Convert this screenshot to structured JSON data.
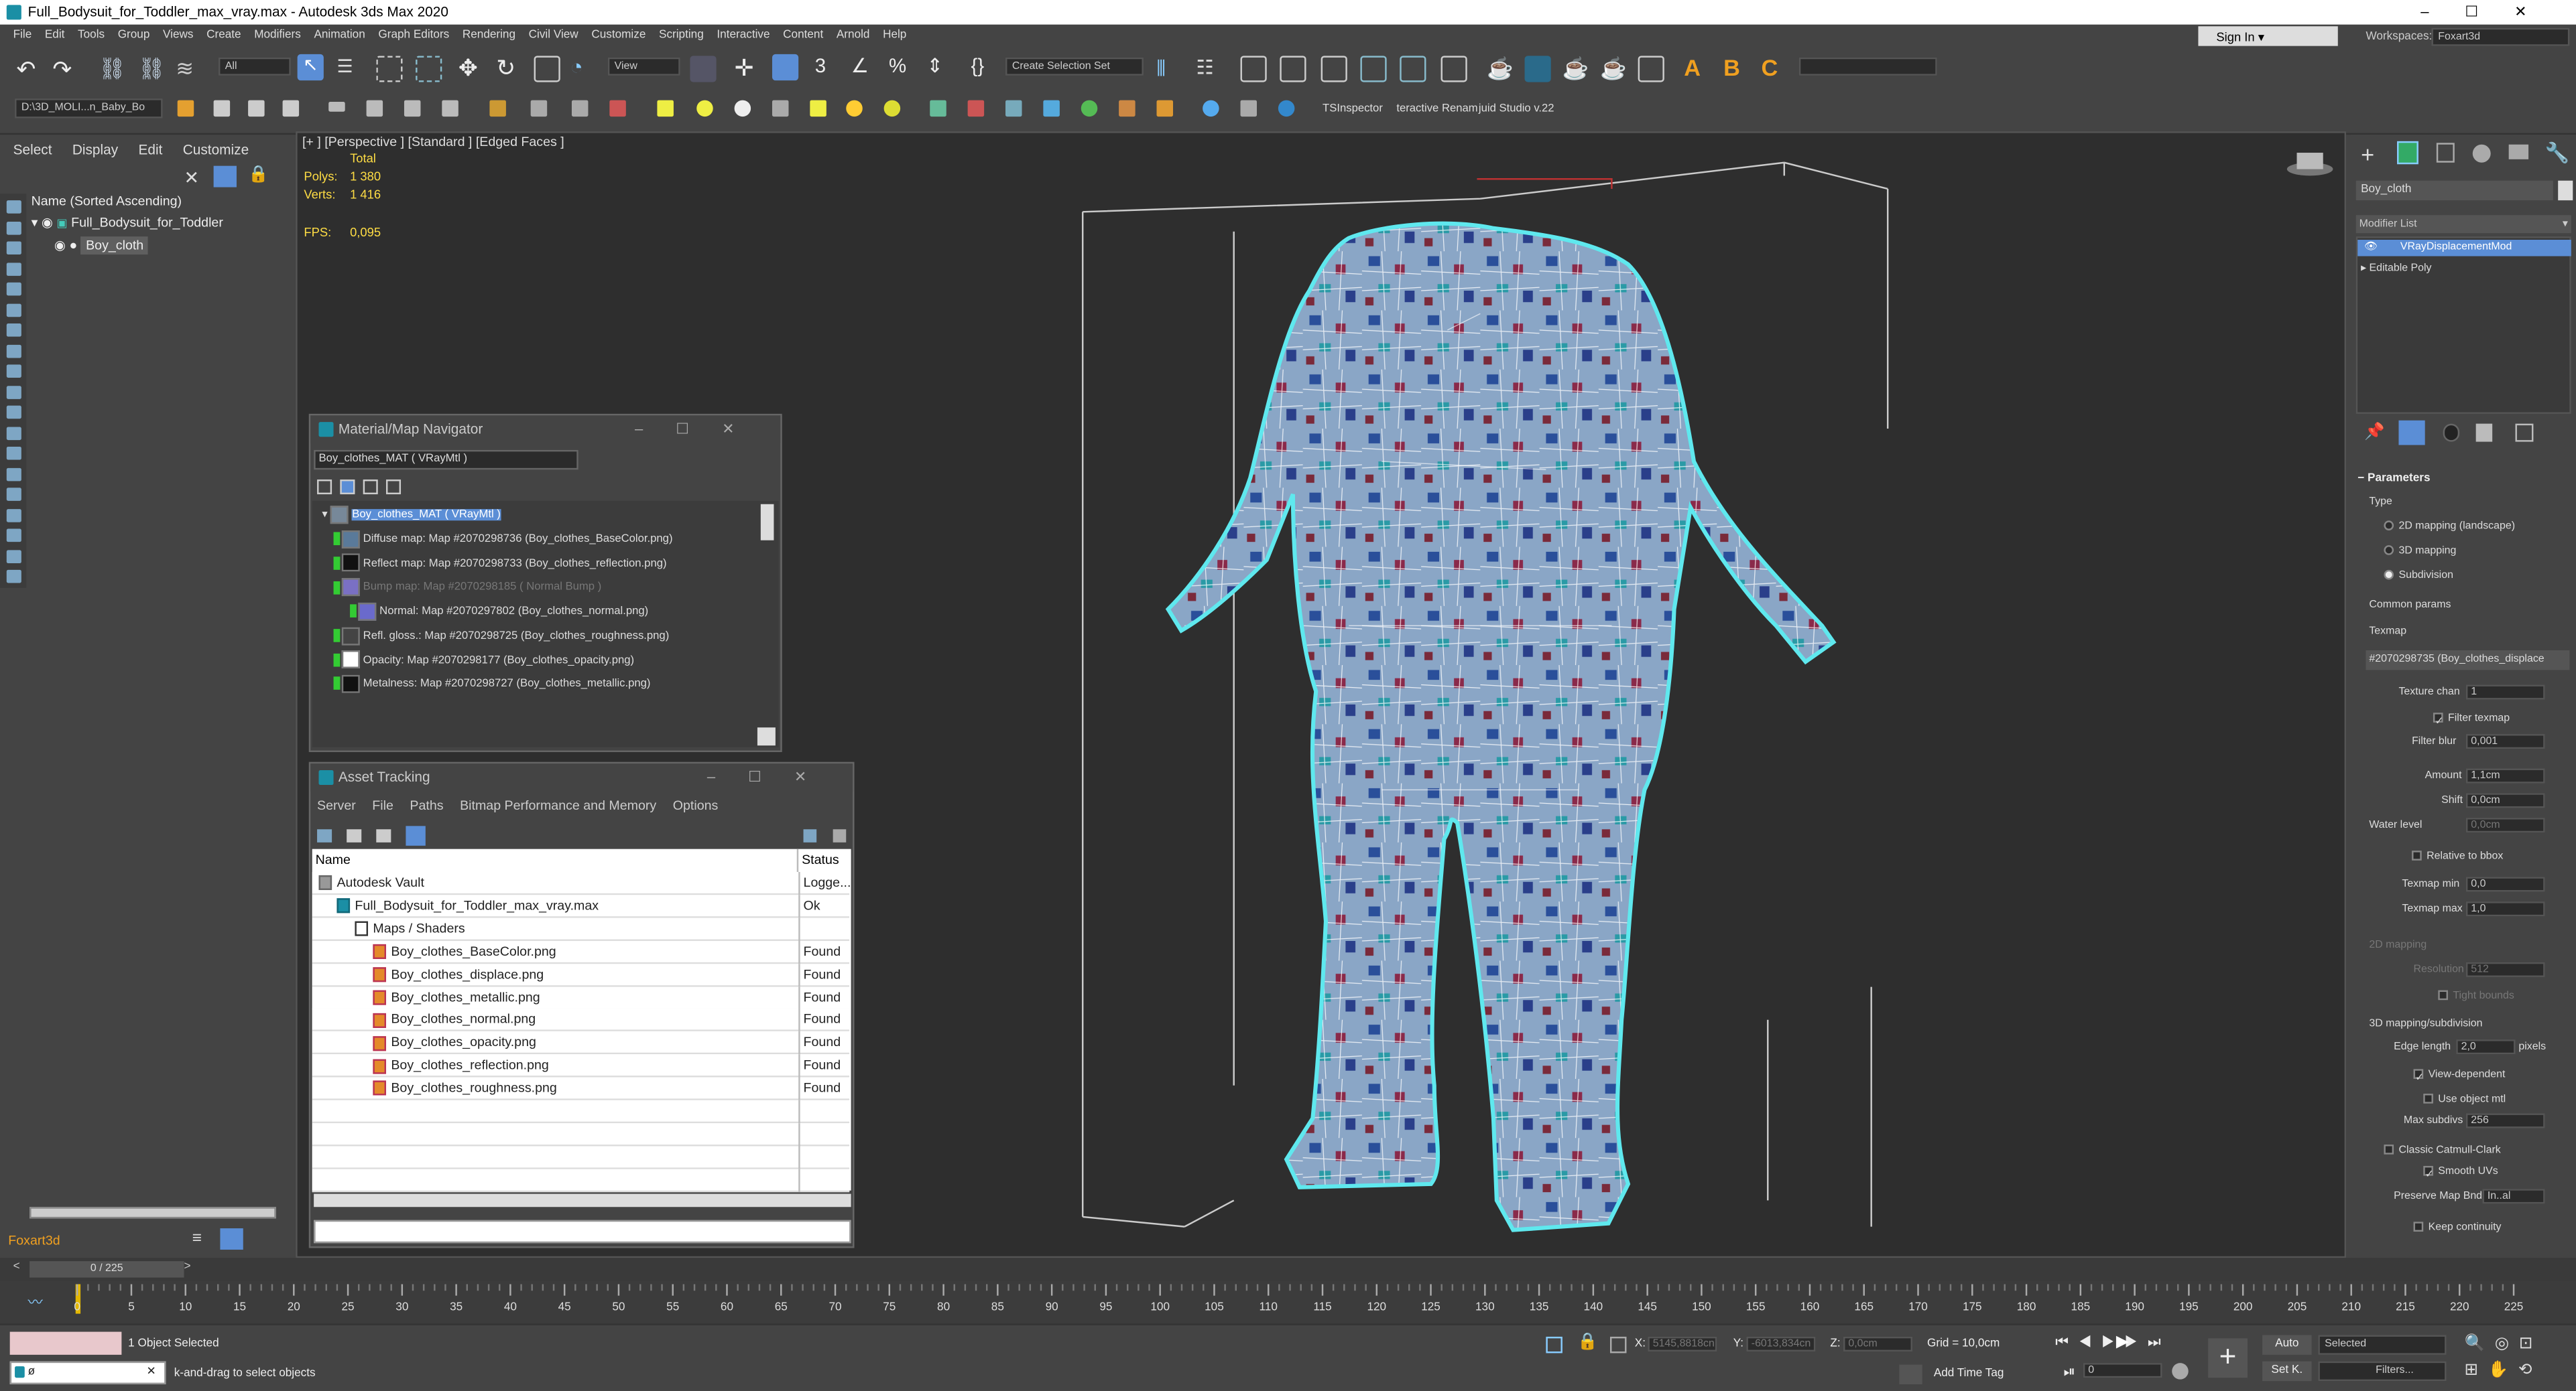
{
  "window": {
    "title": "Full_Bodysuit_for_Toddler_max_vray.max - Autodesk 3ds Max 2020"
  },
  "menu": [
    "File",
    "Edit",
    "Tools",
    "Group",
    "Views",
    "Create",
    "Modifiers",
    "Animation",
    "Graph Editors",
    "Rendering",
    "Civil View",
    "Customize",
    "Scripting",
    "Interactive",
    "Content",
    "Arnold",
    "Help"
  ],
  "signin": {
    "label": "Sign In",
    "workspaces_label": "Workspaces:",
    "workspace": "Foxart3d"
  },
  "toolbar": {
    "filter": "All",
    "view": "View",
    "selection_set": "Create Selection Set",
    "path": "D:\\3D_MOLI...n_Baby_Bo",
    "plugin1": "TSInspector",
    "plugin2": "teractive Renam",
    "plugin3": "juid Studio v.22"
  },
  "scene_explorer": {
    "tabs": [
      "Select",
      "Display",
      "Edit",
      "Customize"
    ],
    "header": "Name (Sorted Ascending)",
    "items": [
      "Full_Bodysuit_for_Toddler",
      "Boy_cloth"
    ]
  },
  "viewport": {
    "label": "[+ ] [Perspective ] [Standard ] [Edged Faces ]",
    "total": "Total",
    "polys_label": "Polys:",
    "polys": "1 380",
    "verts_label": "Verts:",
    "verts": "1 416",
    "fps_label": "FPS:",
    "fps": "0,095"
  },
  "navigator": {
    "title": "Material/Map Navigator",
    "field": "Boy_clothes_MAT  ( VRayMtl )",
    "root": "Boy_clothes_MAT  ( VRayMtl )",
    "rows": [
      {
        "text": "Diffuse map: Map #2070298736 (Boy_clothes_BaseColor.png)",
        "dim": false
      },
      {
        "text": "Reflect map: Map #2070298733 (Boy_clothes_reflection.png)",
        "dim": false
      },
      {
        "text": "Bump map: Map #2070298185  ( Normal Bump )",
        "dim": true
      },
      {
        "text": "Normal: Map #2070297802 (Boy_clothes_normal.png)",
        "dim": false
      },
      {
        "text": "Refl. gloss.: Map #2070298725 (Boy_clothes_roughness.png)",
        "dim": false
      },
      {
        "text": "Opacity: Map #2070298177 (Boy_clothes_opacity.png)",
        "dim": false
      },
      {
        "text": "Metalness: Map #2070298727 (Boy_clothes_metallic.png)",
        "dim": false
      }
    ]
  },
  "asset_tracking": {
    "title": "Asset Tracking",
    "menu": [
      "Server",
      "File",
      "Paths",
      "Bitmap Performance and Memory",
      "Options"
    ],
    "col_name": "Name",
    "col_status": "Status",
    "rows": [
      {
        "name": "Autodesk Vault",
        "status": "Logge...",
        "indent": 0
      },
      {
        "name": "Full_Bodysuit_for_Toddler_max_vray.max",
        "status": "Ok",
        "indent": 1
      },
      {
        "name": "Maps / Shaders",
        "status": "",
        "indent": 2
      },
      {
        "name": "Boy_clothes_BaseColor.png",
        "status": "Found",
        "indent": 3
      },
      {
        "name": "Boy_clothes_displace.png",
        "status": "Found",
        "indent": 3
      },
      {
        "name": "Boy_clothes_metallic.png",
        "status": "Found",
        "indent": 3
      },
      {
        "name": "Boy_clothes_normal.png",
        "status": "Found",
        "indent": 3
      },
      {
        "name": "Boy_clothes_opacity.png",
        "status": "Found",
        "indent": 3
      },
      {
        "name": "Boy_clothes_reflection.png",
        "status": "Found",
        "indent": 3
      },
      {
        "name": "Boy_clothes_roughness.png",
        "status": "Found",
        "indent": 3
      }
    ]
  },
  "command_panel": {
    "object_name": "Boy_cloth",
    "modifier_list": "Modifier List",
    "stack": [
      "VRayDisplacementMod",
      "Editable Poly"
    ],
    "params_title": "Parameters",
    "type_label": "Type",
    "types": [
      "2D mapping (landscape)",
      "3D mapping",
      "Subdivision"
    ],
    "common": "Common params",
    "texmap_label": "Texmap",
    "texmap": "#2070298735 (Boy_clothes_displace",
    "texture_chan_label": "Texture chan",
    "texture_chan": "1",
    "filter_texmap": "Filter texmap",
    "filter_blur_label": "Filter blur",
    "filter_blur": "0,001",
    "amount_label": "Amount",
    "amount": "1,1cm",
    "shift_label": "Shift",
    "shift": "0,0cm",
    "water_label": "Water level",
    "water": "0,0cm",
    "relative": "Relative to bbox",
    "tmin_label": "Texmap min",
    "tmin": "0,0",
    "tmax_label": "Texmap max",
    "tmax": "1,0",
    "m2d": "2D mapping",
    "res_label": "Resolution",
    "res": "512",
    "tight": "Tight bounds",
    "m3d": "3D mapping/subdivision",
    "edge_label": "Edge length",
    "edge": "2,0",
    "pixels": "pixels",
    "view_dep": "View-dependent",
    "use_obj": "Use object mtl",
    "max_subdivs_label": "Max subdivs",
    "max_subdivs": "256",
    "catmull": "Classic Catmull-Clark",
    "smooth_uv": "Smooth UVs",
    "preserve_label": "Preserve Map Bnd",
    "preserve": "In..al",
    "keep": "Keep continuity"
  },
  "workspace_name": "Foxart3d",
  "timeline": {
    "frame": "0 / 225",
    "ticks": [
      "0",
      "5",
      "10",
      "15",
      "20",
      "25",
      "30",
      "35",
      "40",
      "45",
      "50",
      "55",
      "60",
      "65",
      "70",
      "75",
      "80",
      "85",
      "90",
      "95",
      "100",
      "105",
      "110",
      "115",
      "120",
      "125",
      "130",
      "135",
      "140",
      "145",
      "150",
      "155",
      "160",
      "165",
      "170",
      "175",
      "180",
      "185",
      "190",
      "195",
      "200",
      "205",
      "210",
      "215",
      "220",
      "225"
    ]
  },
  "status": {
    "selected": "1 Object Selected",
    "hint": "k-and-drag to select objects",
    "x_label": "X:",
    "x": "5145,8818cn",
    "y_label": "Y:",
    "y": "-6013,834cn",
    "z_label": "Z:",
    "z": "0,0cm",
    "grid": "Grid = 10,0cm",
    "add_tag": "Add Time Tag",
    "auto": "Auto",
    "selected_dd": "Selected",
    "setk": "Set K.",
    "filters": "Filters...",
    "frame_spin": "0"
  }
}
